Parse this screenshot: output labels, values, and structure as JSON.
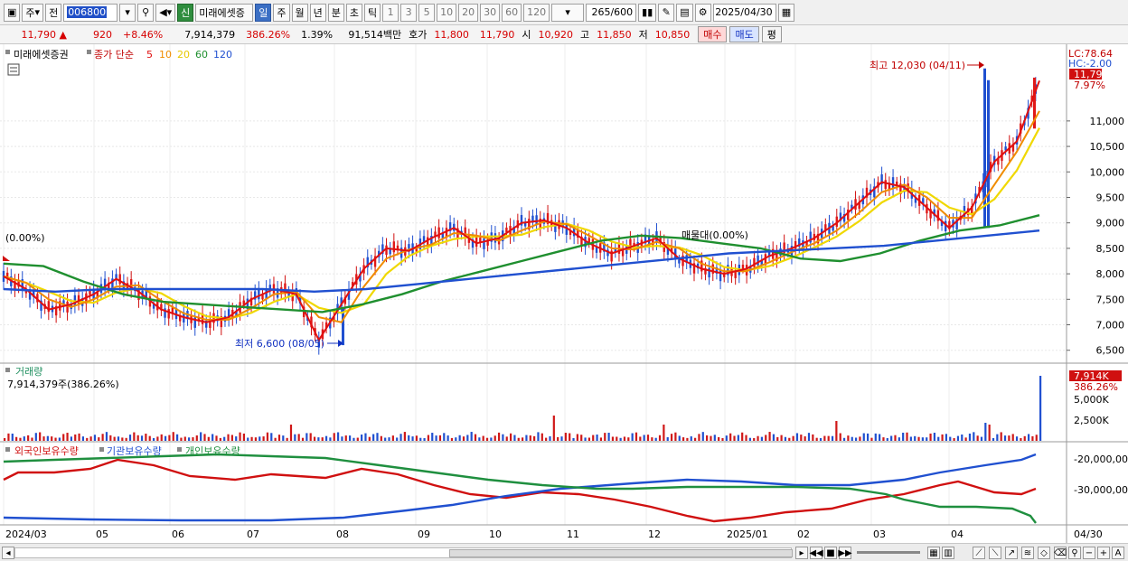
{
  "toolbar": {
    "market": "주",
    "prev": "전",
    "code": "006800",
    "name": "미래에셋증",
    "credit": "신",
    "periods": [
      "일",
      "주",
      "월",
      "년",
      "분",
      "초",
      "틱"
    ],
    "active_period": "일",
    "intervals": [
      "1",
      "3",
      "5",
      "10",
      "20",
      "30",
      "60",
      "120"
    ],
    "count": "265",
    "count_total": "/600",
    "date": "2025/04/30"
  },
  "quote": {
    "price": "11,790 ▲",
    "change": "920",
    "change_pct": "+8.46%",
    "volume": "7,914,379",
    "volume_ratio": "386.26%",
    "turnover": "1.39%",
    "amount": "91,514백만",
    "ask_label": "호가",
    "ask": "11,800",
    "bid": "11,790",
    "open_label": "시",
    "open": "10,920",
    "high_label": "고",
    "high": "11,850",
    "low_label": "저",
    "low": "10,850",
    "buy_label": "매수",
    "sell_label": "매도",
    "eval_label": "평"
  },
  "price_panel": {
    "stock_name": "미래에셋증권",
    "legend_prefix": "종가 단순",
    "ma_labels": [
      "5",
      "10",
      "20",
      "60",
      "120"
    ],
    "ma_colors": [
      "#e01010",
      "#f08c00",
      "#f0d800",
      "#1f8f2f",
      "#2050d0"
    ],
    "lc": "LC:78.64",
    "hc": "HC:-2.00",
    "last_price_tag": "11,790",
    "last_pct_tag": "7.97%",
    "left_label": "(0.00%)",
    "mid_label": "매물대(0.00%)",
    "high_annotation": "최고 12,030 (04/11)",
    "low_annotation": "최저 6,600 (08/05)",
    "y_ticks": [
      "11,000",
      "10,500",
      "10,000",
      "9,500",
      "9,000",
      "8,500",
      "8,000",
      "7,500",
      "7,000",
      "6,500"
    ]
  },
  "volume_panel": {
    "title": "거래량",
    "value_text": "7,914,379주(386.26%)",
    "tag": "7,914K",
    "tag_pct": "386.26%",
    "y_ticks": [
      "5,000K",
      "2,500K"
    ]
  },
  "holdings_panel": {
    "series": [
      "외국인보유수량",
      "기관보유수량",
      "개인보유수량"
    ],
    "series_colors": [
      "#d01010",
      "#2050d0",
      "#1f8f3f"
    ],
    "y_ticks": [
      "-20,000,00",
      "-30,000,00"
    ]
  },
  "x_axis": {
    "labels": [
      "2024/03",
      "05",
      "06",
      "07",
      "08",
      "09",
      "10",
      "11",
      "12",
      "2025/01",
      "02",
      "03",
      "04"
    ],
    "last_label": "04/30"
  },
  "chart_data": {
    "type": "line",
    "title": "",
    "series": [
      {
        "name": "종가",
        "values": [
          7950,
          7700,
          7300,
          7400,
          7600,
          7900,
          7650,
          7300,
          7150,
          7050,
          7150,
          7500,
          7700,
          7600,
          6700,
          7400,
          8100,
          8500,
          8450,
          8700,
          8900,
          8600,
          8700,
          9000,
          9050,
          8900,
          8600,
          8400,
          8550,
          8700,
          8300,
          8100,
          8000,
          8100,
          8350,
          8500,
          8700,
          9000,
          9400,
          9800,
          9700,
          9300,
          8900,
          9300,
          10200,
          10600,
          11790
        ]
      },
      {
        "name": "60",
        "values": [
          8200,
          8150,
          7850,
          7600,
          7450,
          7400,
          7350,
          7300,
          7250,
          7400,
          7600,
          7850,
          8050,
          8250,
          8450,
          8650,
          8750,
          8700,
          8600,
          8500,
          8300,
          8250,
          8400,
          8650,
          8850,
          8950,
          9150
        ]
      },
      {
        "name": "120",
        "values": [
          7700,
          7650,
          7700,
          7700,
          7700,
          7700,
          7650,
          7700,
          7800,
          7900,
          8000,
          8100,
          8200,
          8300,
          8400,
          8450,
          8500,
          8550,
          8650,
          8750,
          8850
        ]
      }
    ]
  }
}
